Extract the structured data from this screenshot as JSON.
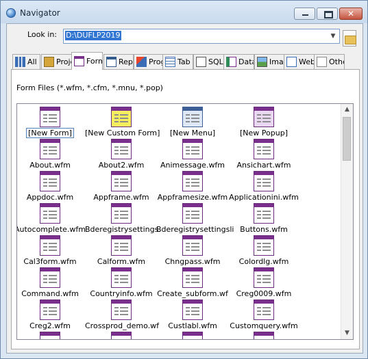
{
  "window": {
    "title": "Navigator"
  },
  "lookin": {
    "label": "Look in:",
    "value": "D:\\DUFLP2019"
  },
  "tabs": [
    {
      "label": "All",
      "icon": "all-files-icon"
    },
    {
      "label": "Proje",
      "icon": "project-icon"
    },
    {
      "label": "Form",
      "icon": "form-icon"
    },
    {
      "label": "Rep",
      "icon": "report-icon"
    },
    {
      "label": "Prog",
      "icon": "program-icon"
    },
    {
      "label": "Tab",
      "icon": "table-icon"
    },
    {
      "label": "SQL",
      "icon": "sql-icon"
    },
    {
      "label": "Data",
      "icon": "datamodule-icon"
    },
    {
      "label": "Imag",
      "icon": "image-icon"
    },
    {
      "label": "Web",
      "icon": "web-icon"
    },
    {
      "label": "Othe",
      "icon": "other-icon"
    }
  ],
  "panel": {
    "files_label": "Form Files (*.wfm, *.cfm, *.mnu, *.pop)"
  },
  "items": [
    "[New Form]",
    "[New Custom Form]",
    "[New Menu]",
    "[New Popup]",
    "About.wfm",
    "About2.wfm",
    "Animessage.wfm",
    "Ansichart.wfm",
    "Appdoc.wfm",
    "Appframe.wfm",
    "Appframesize.wfm",
    "Applicationini.wfm",
    "Autocomplete.wfm",
    "Bderegistrysettings.",
    "Bderegistrysettingsli",
    "Buttons.wfm",
    "Cal3form.wfm",
    "Calform.wfm",
    "Chngpass.wfm",
    "Colordlg.wfm",
    "Command.wfm",
    "Countryinfo.wfm",
    "Create_subform.wf",
    "Creg0009.wfm",
    "Creg2.wfm",
    "Crossprod_demo.wf",
    "Custlabl.wfm",
    "Customquery.wfm",
    "",
    "",
    "",
    ""
  ]
}
